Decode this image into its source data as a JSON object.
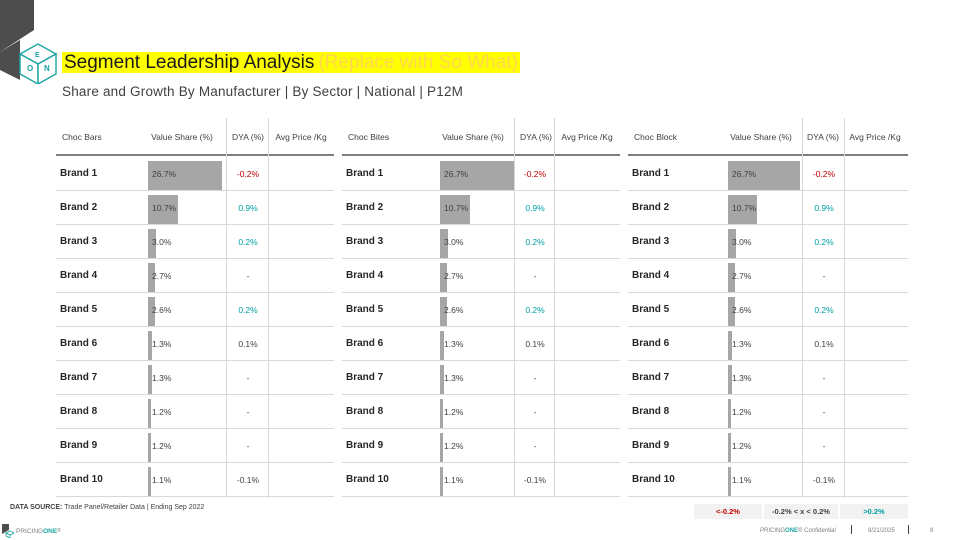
{
  "title": {
    "main": "Segment Leadership Analysis",
    "so_what": "(Replace with So What)"
  },
  "subtitle": "Share and Growth By Manufacturer | By Sector | National | P12M",
  "colors": {
    "negative": "#c00000",
    "positive": "#00a0a0",
    "bar": "#a6a6a6",
    "highlight": "#ffff00",
    "logo": "#4d4d4d",
    "logo_accent": "#1aa3a3"
  },
  "tables": [
    {
      "headers": {
        "segment": "Choc Bars",
        "value_share": "Value Share (%)",
        "dya": "DYA (%)",
        "avg_price": "Avg Price /Kg"
      },
      "rows": [
        {
          "brand": "Brand 1",
          "share": "26.7%",
          "share_value": 26.7,
          "dya": "-0.2%",
          "dya_status": "neg",
          "avg_price": ""
        },
        {
          "brand": "Brand 2",
          "share": "10.7%",
          "share_value": 10.7,
          "dya": "0.9%",
          "dya_status": "pos",
          "avg_price": ""
        },
        {
          "brand": "Brand 3",
          "share": "3.0%",
          "share_value": 3.0,
          "dya": "0.2%",
          "dya_status": "pos",
          "avg_price": ""
        },
        {
          "brand": "Brand 4",
          "share": "2.7%",
          "share_value": 2.7,
          "dya": "-",
          "dya_status": "neu",
          "avg_price": ""
        },
        {
          "brand": "Brand 5",
          "share": "2.6%",
          "share_value": 2.6,
          "dya": "0.2%",
          "dya_status": "pos",
          "avg_price": ""
        },
        {
          "brand": "Brand 6",
          "share": "1.3%",
          "share_value": 1.3,
          "dya": "0.1%",
          "dya_status": "neu",
          "avg_price": ""
        },
        {
          "brand": "Brand 7",
          "share": "1.3%",
          "share_value": 1.3,
          "dya": "-",
          "dya_status": "neu",
          "avg_price": ""
        },
        {
          "brand": "Brand 8",
          "share": "1.2%",
          "share_value": 1.2,
          "dya": "-",
          "dya_status": "neu",
          "avg_price": ""
        },
        {
          "brand": "Brand 9",
          "share": "1.2%",
          "share_value": 1.2,
          "dya": "-",
          "dya_status": "neu",
          "avg_price": ""
        },
        {
          "brand": "Brand 10",
          "share": "1.1%",
          "share_value": 1.1,
          "dya": "-0.1%",
          "dya_status": "neu",
          "avg_price": ""
        }
      ]
    },
    {
      "headers": {
        "segment": "Choc Bites",
        "value_share": "Value Share (%)",
        "dya": "DYA (%)",
        "avg_price": "Avg Price /Kg"
      },
      "rows": [
        {
          "brand": "Brand 1",
          "share": "26.7%",
          "share_value": 26.7,
          "dya": "-0.2%",
          "dya_status": "neg",
          "avg_price": ""
        },
        {
          "brand": "Brand 2",
          "share": "10.7%",
          "share_value": 10.7,
          "dya": "0.9%",
          "dya_status": "pos",
          "avg_price": ""
        },
        {
          "brand": "Brand 3",
          "share": "3.0%",
          "share_value": 3.0,
          "dya": "0.2%",
          "dya_status": "pos",
          "avg_price": ""
        },
        {
          "brand": "Brand 4",
          "share": "2.7%",
          "share_value": 2.7,
          "dya": "-",
          "dya_status": "neu",
          "avg_price": ""
        },
        {
          "brand": "Brand 5",
          "share": "2.6%",
          "share_value": 2.6,
          "dya": "0.2%",
          "dya_status": "pos",
          "avg_price": ""
        },
        {
          "brand": "Brand 6",
          "share": "1.3%",
          "share_value": 1.3,
          "dya": "0.1%",
          "dya_status": "neu",
          "avg_price": ""
        },
        {
          "brand": "Brand 7",
          "share": "1.3%",
          "share_value": 1.3,
          "dya": "-",
          "dya_status": "neu",
          "avg_price": ""
        },
        {
          "brand": "Brand 8",
          "share": "1.2%",
          "share_value": 1.2,
          "dya": "-",
          "dya_status": "neu",
          "avg_price": ""
        },
        {
          "brand": "Brand 9",
          "share": "1.2%",
          "share_value": 1.2,
          "dya": "-",
          "dya_status": "neu",
          "avg_price": ""
        },
        {
          "brand": "Brand 10",
          "share": "1.1%",
          "share_value": 1.1,
          "dya": "-0.1%",
          "dya_status": "neu",
          "avg_price": ""
        }
      ]
    },
    {
      "headers": {
        "segment": "Choc Block",
        "value_share": "Value Share (%)",
        "dya": "DYA (%)",
        "avg_price": "Avg Price /Kg"
      },
      "rows": [
        {
          "brand": "Brand 1",
          "share": "26.7%",
          "share_value": 26.7,
          "dya": "-0.2%",
          "dya_status": "neg",
          "avg_price": ""
        },
        {
          "brand": "Brand 2",
          "share": "10.7%",
          "share_value": 10.7,
          "dya": "0.9%",
          "dya_status": "pos",
          "avg_price": ""
        },
        {
          "brand": "Brand 3",
          "share": "3.0%",
          "share_value": 3.0,
          "dya": "0.2%",
          "dya_status": "pos",
          "avg_price": ""
        },
        {
          "brand": "Brand 4",
          "share": "2.7%",
          "share_value": 2.7,
          "dya": "-",
          "dya_status": "neu",
          "avg_price": ""
        },
        {
          "brand": "Brand 5",
          "share": "2.6%",
          "share_value": 2.6,
          "dya": "0.2%",
          "dya_status": "pos",
          "avg_price": ""
        },
        {
          "brand": "Brand 6",
          "share": "1.3%",
          "share_value": 1.3,
          "dya": "0.1%",
          "dya_status": "neu",
          "avg_price": ""
        },
        {
          "brand": "Brand 7",
          "share": "1.3%",
          "share_value": 1.3,
          "dya": "-",
          "dya_status": "neu",
          "avg_price": ""
        },
        {
          "brand": "Brand 8",
          "share": "1.2%",
          "share_value": 1.2,
          "dya": "-",
          "dya_status": "neu",
          "avg_price": ""
        },
        {
          "brand": "Brand 9",
          "share": "1.2%",
          "share_value": 1.2,
          "dya": "-",
          "dya_status": "neu",
          "avg_price": ""
        },
        {
          "brand": "Brand 10",
          "share": "1.1%",
          "share_value": 1.1,
          "dya": "-0.1%",
          "dya_status": "neu",
          "avg_price": ""
        }
      ]
    }
  ],
  "source": {
    "label": "DATA SOURCE:",
    "text": "Trade Panel/Retailer Data | Ending Sep 2022"
  },
  "legend": {
    "neg": "<-0.2%",
    "neutral": "-0.2% < x < 0.2%",
    "pos": ">0.2%"
  },
  "footer": {
    "brand_prefix": "PRICING",
    "brand_suffix": "ONE",
    "brand_tm": "®",
    "confidential": "Confidential",
    "date": "8/21/2025",
    "page": "8",
    "logo_letters": [
      "O",
      "N",
      "E"
    ]
  }
}
